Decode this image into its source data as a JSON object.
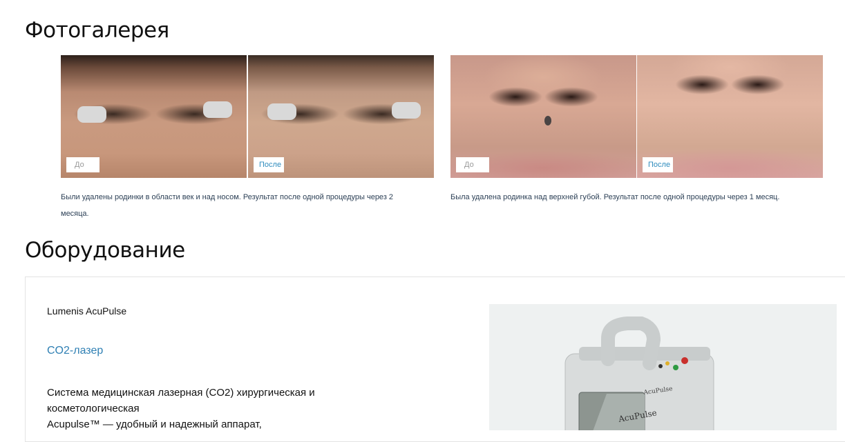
{
  "gallery": {
    "title": "Фотогалерея",
    "items": [
      {
        "before_label": "До",
        "after_label": "После",
        "caption_line1": "Были удалены родинки в области век и над носом. Результат после одной процедуры через 2",
        "caption_line2": "месяца."
      },
      {
        "before_label": "До",
        "after_label": "После",
        "caption_line1": "Была удалена родинка над верхней губой. Результат после одной процедуры через 1 месяц.",
        "caption_line2": ""
      }
    ]
  },
  "equipment": {
    "title": "Оборудование",
    "name": "Lumenis AcuPulse",
    "type_link": "CO2-лазер",
    "description_line1": "Система медицинская лазерная (CO2) хирургическая и",
    "description_line2": "косметологическая",
    "description_line3": "Acupulse™ — удобный и надежный аппарат,",
    "device_label_top": "AcuPulse",
    "device_label_screen": "AcuPulse"
  },
  "colors": {
    "accent": "#2e7fb3",
    "caption_text": "#2b3f55"
  }
}
